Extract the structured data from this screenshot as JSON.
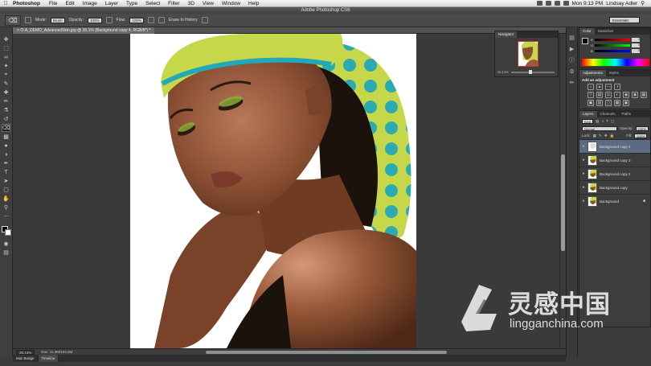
{
  "menubar": {
    "app_name": "Photoshop",
    "items": [
      "File",
      "Edit",
      "Image",
      "Layer",
      "Type",
      "Select",
      "Filter",
      "3D",
      "View",
      "Window",
      "Help"
    ],
    "clock": "Mon 9:13 PM",
    "user": "Lindsay Adler"
  },
  "window": {
    "title": "Adobe Photoshop CS6"
  },
  "options": {
    "mode_label": "Mode:",
    "mode_value": "Brush",
    "opacity_label": "Opacity:",
    "opacity_value": "100%",
    "flow_label": "Flow:",
    "flow_value": "100%",
    "erase_history": "Erase to History",
    "workspace": "Essentials"
  },
  "document": {
    "tab_label": "O-A_DEMO_AdvancedSkin.jpg @ 35.1% (Background copy 4, RGB/8*) *",
    "zoom": "35.13%",
    "doc_info": "Doc: 11.3M/103.2M"
  },
  "bottom_tabs": [
    "Mini Bridge",
    "Timeline"
  ],
  "navigator": {
    "tab": "Navigator",
    "zoom": "35.13%"
  },
  "color_panel": {
    "tabs": [
      "Color",
      "Swatches"
    ],
    "rows": [
      {
        "label": "R",
        "value": "0",
        "gradient": "linear-gradient(90deg,#000,#ff0000)"
      },
      {
        "label": "G",
        "value": "0",
        "gradient": "linear-gradient(90deg,#000,#00ff00)"
      },
      {
        "label": "B",
        "value": "0",
        "gradient": "linear-gradient(90deg,#000,#0000ff)"
      }
    ]
  },
  "adjustments": {
    "tabs": [
      "Adjustments",
      "Styles"
    ],
    "title": "Add an adjustment"
  },
  "layers": {
    "tabs": [
      "Layers",
      "Channels",
      "Paths"
    ],
    "kind_label": "Kind",
    "blend_mode": "Normal",
    "opacity_label": "Opacity:",
    "opacity_value": "100%",
    "lock_label": "Lock:",
    "fill_label": "Fill:",
    "fill_value": "100%",
    "items": [
      {
        "name": "Background copy 4",
        "active": true
      },
      {
        "name": "Background copy 3",
        "active": false
      },
      {
        "name": "Background copy 2",
        "active": false
      },
      {
        "name": "Background copy",
        "active": false
      },
      {
        "name": "Background",
        "active": false,
        "locked": true
      }
    ]
  },
  "watermark": {
    "cn": "灵感中国",
    "en": "lingganchina.com"
  },
  "colors": {
    "scarf_yellow": "#c6d84a",
    "scarf_teal": "#22a8b8",
    "skin": "#8a4f33",
    "skin_light": "#b8785a",
    "hair": "#1b120c"
  }
}
